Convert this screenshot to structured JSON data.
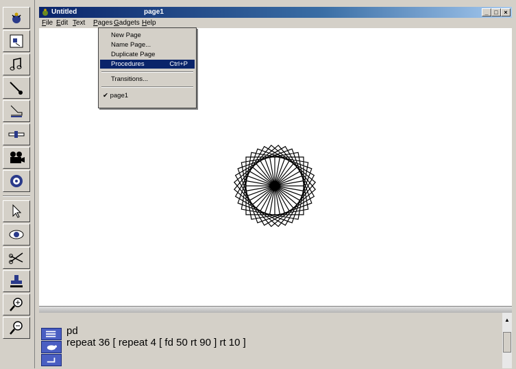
{
  "window": {
    "title": "Untitled",
    "page_name": "page1"
  },
  "menu": {
    "items": [
      {
        "prefix": "",
        "u": "F",
        "rest": "ile"
      },
      {
        "prefix": "",
        "u": "E",
        "rest": "dit"
      },
      {
        "prefix": "",
        "u": "T",
        "rest": "ext"
      },
      {
        "prefix": "",
        "u": "P",
        "rest": "ages"
      },
      {
        "prefix": "",
        "u": "G",
        "rest": "adgets"
      },
      {
        "prefix": "",
        "u": "H",
        "rest": "elp"
      }
    ]
  },
  "pages_menu": {
    "new_page": "New Page",
    "name_page": "Name Page...",
    "duplicate_page": "Duplicate Page",
    "procedures": "Procedures",
    "procedures_shortcut": "Ctrl+P",
    "transitions": "Transitions...",
    "current_page_check": "✔",
    "current_page": "page1"
  },
  "command_center": {
    "lines": [
      "pd",
      "repeat 36 [ repeat 4 [ fd 50 rt 90 ] rt 10 ]"
    ]
  },
  "drawing": {
    "shape": "square",
    "repeat": 36,
    "side": 50,
    "turn_inner": 90,
    "turn_outer": 10
  },
  "palette": {
    "tools": [
      "turtle-icon",
      "shapes-icon",
      "music-icon",
      "paint-brush-icon",
      "stamp-icon",
      "slider-icon",
      "camera-icon",
      "sound-icon",
      "pointer-icon",
      "eye-icon",
      "scissors-icon",
      "stamp-tool-icon",
      "zoom-in-icon",
      "zoom-out-icon"
    ]
  },
  "colors": {
    "accent": "#0a246a",
    "command_button": "#4a5ec2",
    "chrome": "#d4d0c8"
  }
}
